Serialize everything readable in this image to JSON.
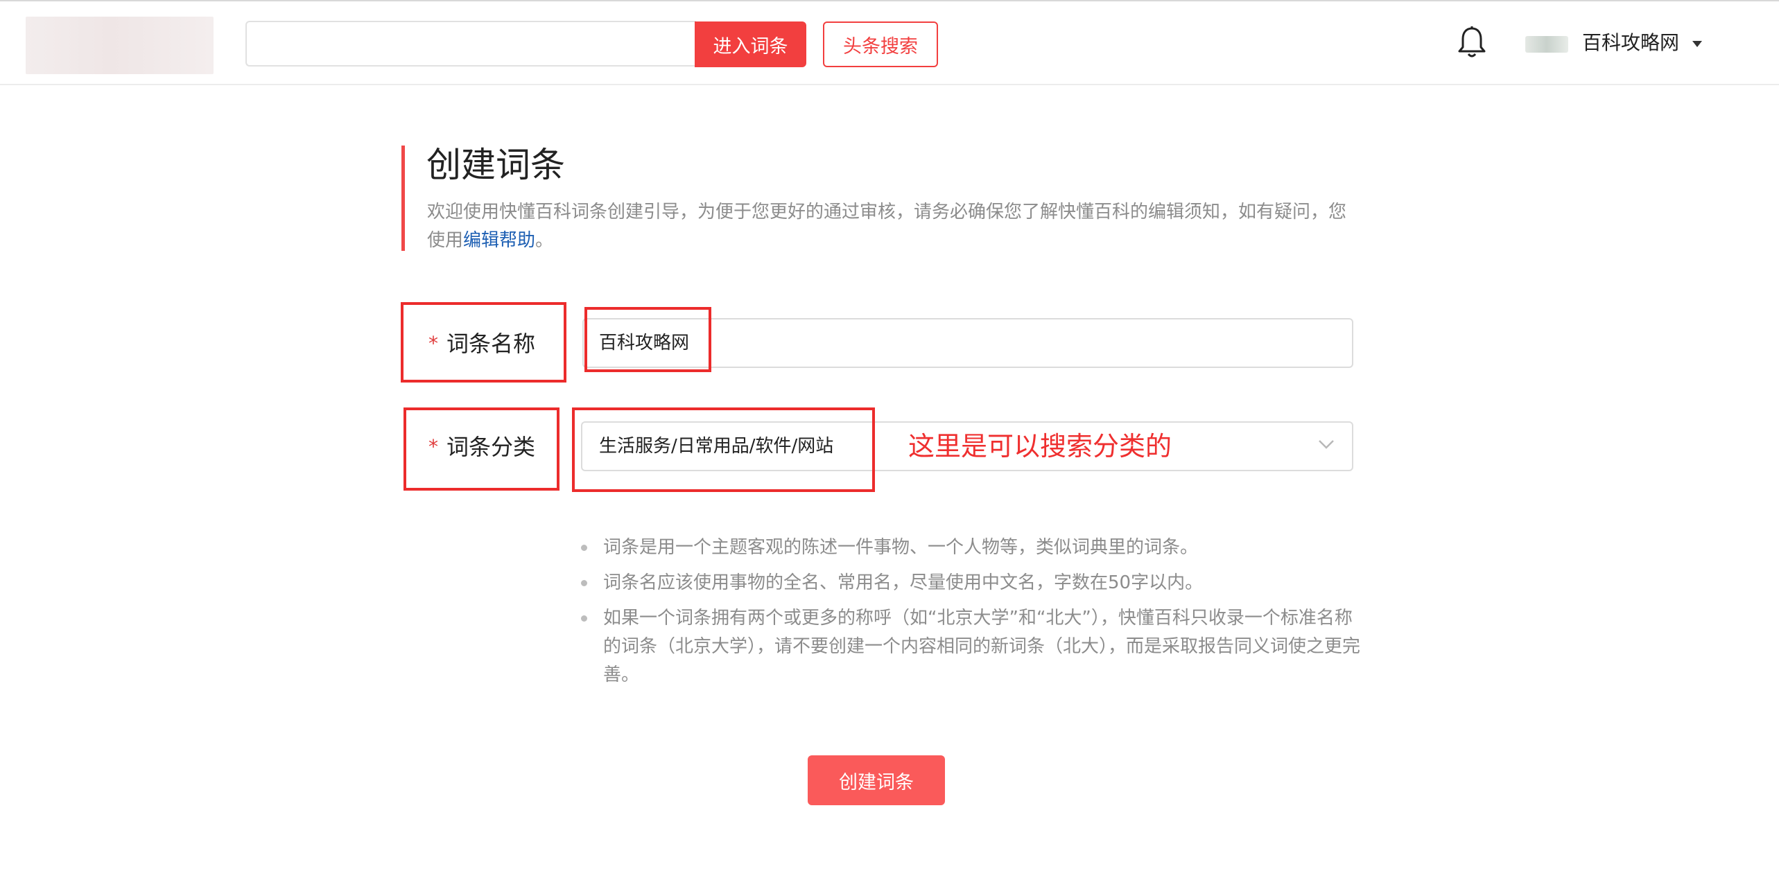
{
  "header": {
    "search_placeholder": "",
    "enter_label": "进入词条",
    "headline_search_label": "头条搜索",
    "user_name": "百科攻略网",
    "icons": {
      "notify": "bell-icon",
      "menu": "caret-down-icon"
    }
  },
  "intro": {
    "title": "创建词条",
    "text_before_link": "欢迎使用快懂百科词条创建引导，为便于您更好的通过审核，请务必确保您了解快懂百科的编辑须知，如有疑问，您使用",
    "link_label": "编辑帮助",
    "text_after_link": "。"
  },
  "form": {
    "required_mark": "*",
    "name_label": "词条名称",
    "name_value": "百科攻略网",
    "category_label": "词条分类",
    "category_value": "生活服务/日常用品/软件/网站",
    "annotation": "这里是可以搜索分类的"
  },
  "tips": [
    "词条是用一个主题客观的陈述一件事物、一个人物等，类似词典里的词条。",
    "词条名应该使用事物的全名、常用名，尽量使用中文名，字数在50字以内。",
    "如果一个词条拥有两个或更多的称呼（如“北京大学”和“北大”），快懂百科只收录一个标准名称的词条（北京大学），请不要创建一个内容相同的新词条（北大），而是采取报告同义词使之更完善。"
  ],
  "submit": {
    "label": "创建词条"
  },
  "colors": {
    "accent": "#f23f3f",
    "submit": "#fa5a5a",
    "link": "#1d5fb3",
    "annotation": "#ef2f2f",
    "muted_text": "#8c8c8c"
  }
}
